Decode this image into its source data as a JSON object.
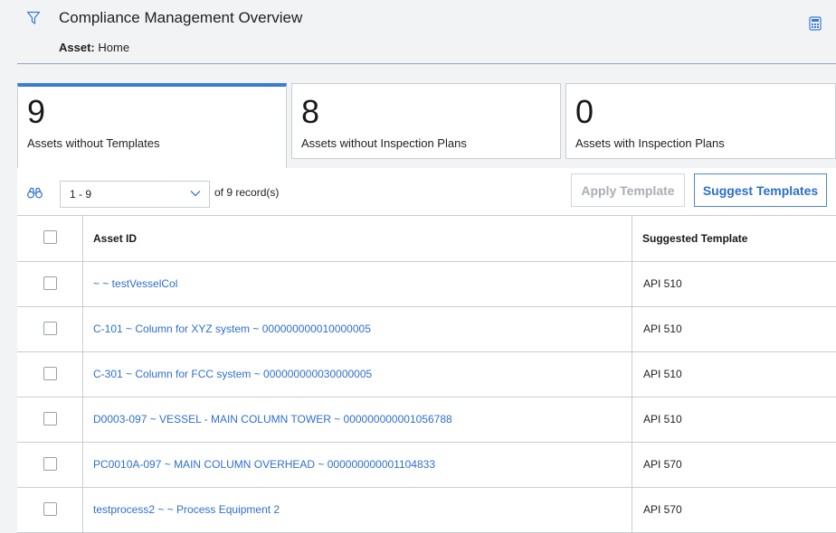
{
  "header": {
    "title": "Compliance Management Overview",
    "asset_label": "Asset:",
    "asset_value": "Home"
  },
  "tiles": [
    {
      "count": "9",
      "label": "Assets without Templates",
      "active": true
    },
    {
      "count": "8",
      "label": "Assets without Inspection Plans",
      "active": false
    },
    {
      "count": "0",
      "label": "Assets with Inspection Plans",
      "active": false
    }
  ],
  "toolbar": {
    "pager_value": "1 - 9",
    "of_text": "of 9  record(s)",
    "apply_label": "Apply Template",
    "suggest_label": "Suggest Templates"
  },
  "table": {
    "columns": [
      "Asset ID",
      "Suggested Template"
    ],
    "rows": [
      {
        "asset_id": "~ ~ testVesselCol",
        "template": "API 510"
      },
      {
        "asset_id": "C-101 ~ Column for XYZ system ~ 000000000010000005",
        "template": "API 510"
      },
      {
        "asset_id": "C-301 ~ Column for FCC system ~ 000000000030000005",
        "template": "API 510"
      },
      {
        "asset_id": "D0003-097 ~ VESSEL - MAIN COLUMN TOWER ~ 000000000001056788",
        "template": "API 510"
      },
      {
        "asset_id": "PC0010A-097 ~ MAIN COLUMN OVERHEAD ~ 000000000001104833",
        "template": "API 570"
      },
      {
        "asset_id": "testprocess2 ~ ~ Process Equipment 2",
        "template": "API 570"
      }
    ]
  },
  "icons": {
    "filter": "filter-icon",
    "calculator": "calculator-icon",
    "binoculars": "binoculars-icon",
    "chevron": "chevron-down-icon"
  },
  "colors": {
    "accent": "#3a7bd5",
    "link": "#2f6fcf"
  }
}
